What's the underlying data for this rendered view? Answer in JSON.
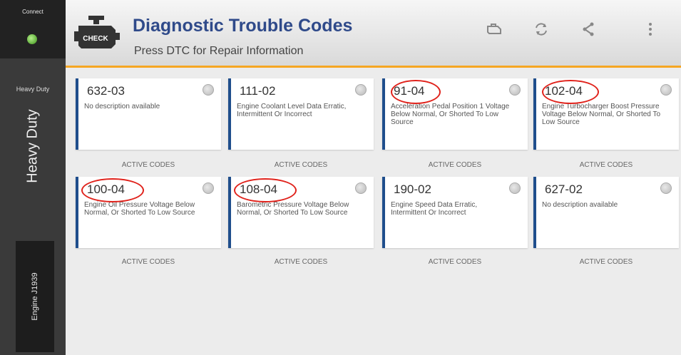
{
  "sidebar": {
    "connect_label": "Connect",
    "connection_status_color": "#5fae3a",
    "mode_small": "Heavy Duty",
    "mode_big": "Heavy Duty",
    "protocol": "Engine J1939"
  },
  "header": {
    "icon_text": "CHECK",
    "title": "Diagnostic Trouble Codes",
    "subtitle": "Press DTC for Repair Information",
    "actions": [
      "engine-icon",
      "refresh-icon",
      "share-icon",
      "more-vertical-icon"
    ]
  },
  "dtc_cards": [
    {
      "code": "632-03",
      "description": "No description available",
      "status": "ACTIVE CODES",
      "circled": false
    },
    {
      "code": "111-02",
      "description": "Engine Coolant Level Data Erratic, Intermittent Or Incorrect",
      "status": "ACTIVE CODES",
      "circled": false
    },
    {
      "code": "91-04",
      "description": "Acceleration Pedal Position 1 Voltage Below Normal, Or Shorted To Low Source",
      "status": "ACTIVE CODES",
      "circled": true
    },
    {
      "code": "102-04",
      "description": "Engine Turbocharger Boost Pressure Voltage Below Normal, Or Shorted To Low Source",
      "status": "ACTIVE CODES",
      "circled": true
    },
    {
      "code": "100-04",
      "description": "Engine Oil Pressure Voltage Below Normal, Or Shorted To Low Source",
      "status": "ACTIVE CODES",
      "circled": true
    },
    {
      "code": "108-04",
      "description": "Barometric Pressure Voltage Below Normal, Or Shorted To Low Source",
      "status": "ACTIVE CODES",
      "circled": true
    },
    {
      "code": "190-02",
      "description": "Engine Speed Data Erratic, Intermittent Or Incorrect",
      "status": "ACTIVE CODES",
      "circled": false
    },
    {
      "code": "627-02",
      "description": "No description available",
      "status": "ACTIVE CODES",
      "circled": false
    }
  ],
  "colors": {
    "accent": "#1f4e8c",
    "title": "#2f4a8a",
    "header_underline": "#f5a623",
    "annotation": "#e0221b"
  }
}
